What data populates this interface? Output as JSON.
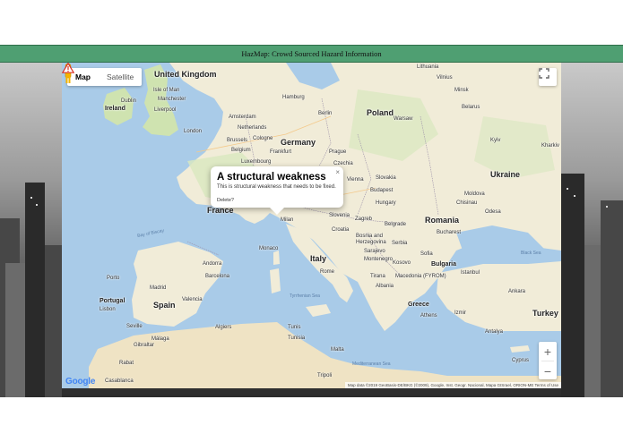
{
  "header": {
    "title": "HazMap: Crowd Sourced Hazard Information"
  },
  "map": {
    "type_controls": {
      "map_label": "Map",
      "satellite_label": "Satellite",
      "selected": "Map"
    },
    "fullscreen_icon": "fullscreen-icon",
    "zoom": {
      "in_label": "+",
      "out_label": "−"
    },
    "pegman_icon": "pegman-icon",
    "google_logo": "Google",
    "attribution": "Map data ©2019 GeoBasis-DE/BKG (©2009), Google, Inst. Geogr. Nacional, Mapa GISrael, ORION-ME   Terms of Use",
    "info_window": {
      "title": "A structural weakness",
      "body": "This is structural weakness that needs to be fixed.",
      "delete_label": "Delete?",
      "close_label": "×"
    },
    "marker_icon": "hazard-triangle-icon",
    "labels": {
      "united_kingdom": "United Kingdom",
      "ireland": "Ireland",
      "dublin": "Dublin",
      "liverpool": "Liverpool",
      "manchester": "Manchester",
      "isle_of_man": "Isle of Man",
      "london": "London",
      "netherlands": "Netherlands",
      "amsterdam": "Amsterdam",
      "hamburg": "Hamburg",
      "berlin": "Berlin",
      "germany": "Germany",
      "brussels": "Brussels",
      "belgium": "Belgium",
      "cologne": "Cologne",
      "frankfurt": "Frankfurt",
      "luxembourg": "Luxembourg",
      "prague": "Prague",
      "czechia": "Czechia",
      "poland": "Poland",
      "warsaw": "Warsaw",
      "lithuania": "Lithuania",
      "vilnius": "Vilnius",
      "belarus": "Belarus",
      "minsk": "Minsk",
      "ukraine": "Ukraine",
      "kyiv": "Kyiv",
      "kharkiv": "Kharkiv",
      "slovakia": "Slovakia",
      "vienna": "Vienna",
      "budapest": "Budapest",
      "hungary": "Hungary",
      "moldova": "Moldova",
      "chisinau": "Chisinau",
      "odesa": "Odesa",
      "romania": "Romania",
      "bucharest": "Bucharest",
      "france": "France",
      "milan": "Milan",
      "slovenia": "Slovenia",
      "zagreb": "Zagreb",
      "croatia": "Croatia",
      "bosnia": "Bosnia and Herzegovina",
      "serbia": "Serbia",
      "belgrade": "Belgrade",
      "sarajevo": "Sarajevo",
      "montenegro": "Montenegro",
      "kosovo": "Kosovo",
      "sofia": "Sofia",
      "bulgaria": "Bulgaria",
      "macedonia": "Macedonia (FYROM)",
      "albania": "Albania",
      "tirana": "Tirana",
      "monaco": "Monaco",
      "italy": "Italy",
      "rome": "Rome",
      "andorra": "Andorra",
      "barcelona": "Barcelona",
      "madrid": "Madrid",
      "spain": "Spain",
      "valencia": "Valencia",
      "portugal": "Portugal",
      "lisbon": "Lisbon",
      "porto": "Porto",
      "seville": "Seville",
      "malaga": "Málaga",
      "gibraltar": "Gibraltar",
      "algiers": "Algiers",
      "tunis": "Tunis",
      "tunisia": "Tunisia",
      "rabat": "Rabat",
      "casablanca": "Casablanca",
      "malta": "Malta",
      "tripoli": "Tripoli",
      "greece": "Greece",
      "athens": "Athens",
      "izmir": "Izmir",
      "turkey": "Turkey",
      "ankara": "Ankara",
      "antalya": "Antalya",
      "cyprus": "Cyprus",
      "istanbul": "Istanbul",
      "bay_of_biscay": "Bay of Biscay",
      "black_sea": "Black Sea",
      "tyrrhenian_sea": "Tyrrhenian Sea",
      "mediterranean_sea": "Mediterranean Sea"
    }
  },
  "colors": {
    "header_bg": "#4f9f72",
    "water": "#a9cbe8",
    "land": "#f1ecd8",
    "land_green": "#cfe3b0"
  }
}
